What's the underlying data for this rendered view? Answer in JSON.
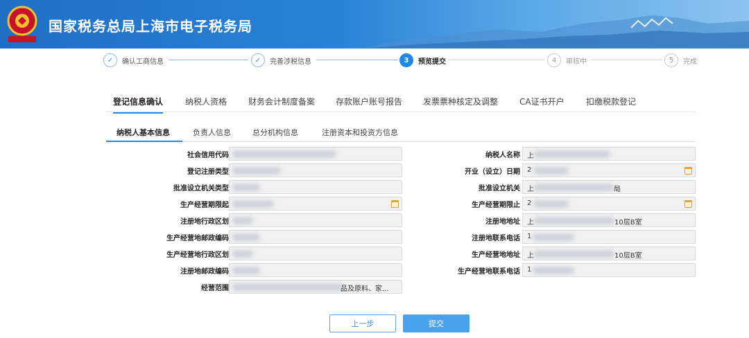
{
  "header": {
    "title": "国家税务总局上海市电子税务局",
    "emblem_icon": "tax-emblem-icon"
  },
  "steps": [
    {
      "num": "",
      "label": "确认工商信息",
      "state": "done"
    },
    {
      "num": "",
      "label": "完善涉税信息",
      "state": "done"
    },
    {
      "num": "3",
      "label": "预览提交",
      "state": "active"
    },
    {
      "num": "4",
      "label": "审核中",
      "state": "todo"
    },
    {
      "num": "5",
      "label": "完成",
      "state": "todo"
    }
  ],
  "tabs": [
    "登记信息确认",
    "纳税人资格",
    "财务会计制度备案",
    "存款账户账号报告",
    "发票票种核定及调整",
    "CA证书开户",
    "扣缴税款登记"
  ],
  "subtabs": [
    "纳税人基本信息",
    "负责人信息",
    "总分机构信息",
    "注册资本和投资方信息"
  ],
  "form_left": [
    {
      "label": "社会信用代码",
      "value": ""
    },
    {
      "label": "登记注册类型",
      "value": ""
    },
    {
      "label": "批准设立机关类型",
      "value": ""
    },
    {
      "label": "生产经营期限起",
      "value": "",
      "date": true
    },
    {
      "label": "注册地行政区划",
      "value": ""
    },
    {
      "label": "生产经营地邮政编码",
      "value": ""
    },
    {
      "label": "生产经营地行政区划",
      "value": ""
    },
    {
      "label": "注册地邮政编码",
      "value": ""
    },
    {
      "label": "经营范围",
      "value": "",
      "tail": "品及原料、家..."
    }
  ],
  "form_right": [
    {
      "label": "纳税人名称",
      "value": "上"
    },
    {
      "label": "开业（设立）日期",
      "value": "2",
      "date": true
    },
    {
      "label": "批准设立机关",
      "value": "上",
      "tail": "局"
    },
    {
      "label": "生产经营期限止",
      "value": "2",
      "date": true
    },
    {
      "label": "注册地地址",
      "value": "上",
      "tail": "10层B室"
    },
    {
      "label": "注册地联系电话",
      "value": "1"
    },
    {
      "label": "生产经营地地址",
      "value": "上",
      "tail": "10层B室"
    },
    {
      "label": "生产经营地联系电话",
      "value": "1"
    }
  ],
  "buttons": {
    "prev": "上一步",
    "submit": "提交"
  },
  "colors": {
    "primary": "#1e88e5",
    "header": "#1f6fc4",
    "calendar": "#e3a532"
  }
}
